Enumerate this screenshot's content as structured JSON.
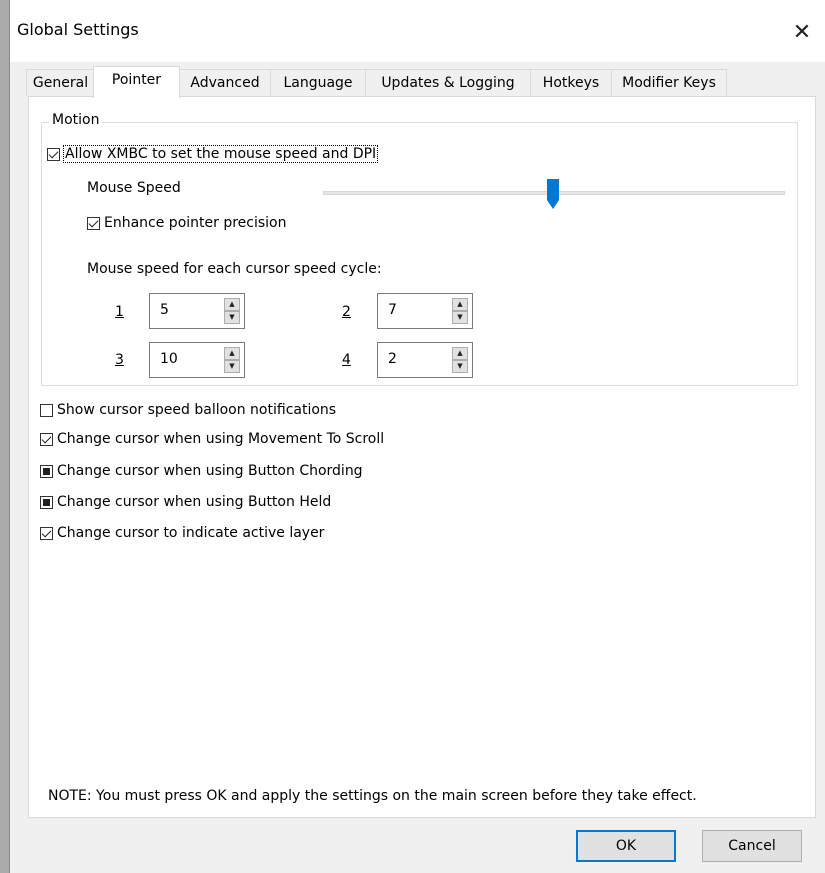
{
  "window": {
    "title": "Global Settings"
  },
  "tabs": [
    {
      "label": "General",
      "active": false
    },
    {
      "label": "Pointer",
      "active": true
    },
    {
      "label": "Advanced",
      "active": false
    },
    {
      "label": "Language",
      "active": false
    },
    {
      "label": "Updates & Logging",
      "active": false
    },
    {
      "label": "Hotkeys",
      "active": false
    },
    {
      "label": "Modifier Keys",
      "active": false
    }
  ],
  "motion": {
    "legend": "Motion",
    "allow_label": "Allow XMBC to set the mouse speed and DPI",
    "allow_checked": true,
    "mouse_speed_label": "Mouse Speed",
    "mouse_speed_fraction": 0.5,
    "enhance_label": "Enhance pointer precision",
    "enhance_checked": true,
    "cycle_heading": "Mouse speed for each cursor speed cycle:",
    "cycles": [
      {
        "label": "1",
        "value": "5"
      },
      {
        "label": "2",
        "value": "7"
      },
      {
        "label": "3",
        "value": "10"
      },
      {
        "label": "4",
        "value": "2"
      }
    ]
  },
  "options": [
    {
      "label": "Show cursor speed balloon notifications",
      "state": "unchecked"
    },
    {
      "label": "Change cursor when using Movement To Scroll",
      "state": "checked"
    },
    {
      "label": "Change cursor when using Button Chording",
      "state": "indeterminate"
    },
    {
      "label": "Change cursor when using Button Held",
      "state": "indeterminate"
    },
    {
      "label": "Change cursor to indicate active layer",
      "state": "checked"
    }
  ],
  "note": "NOTE: You must press OK and apply the settings on the main screen before they take effect.",
  "buttons": {
    "ok": "OK",
    "cancel": "Cancel"
  },
  "colors": {
    "accent": "#0078d7",
    "panel": "#ffffff",
    "dialog": "#f0f0f0"
  },
  "icons": {
    "close": "close-icon",
    "spin_up": "spin-up-icon",
    "spin_down": "spin-down-icon"
  }
}
